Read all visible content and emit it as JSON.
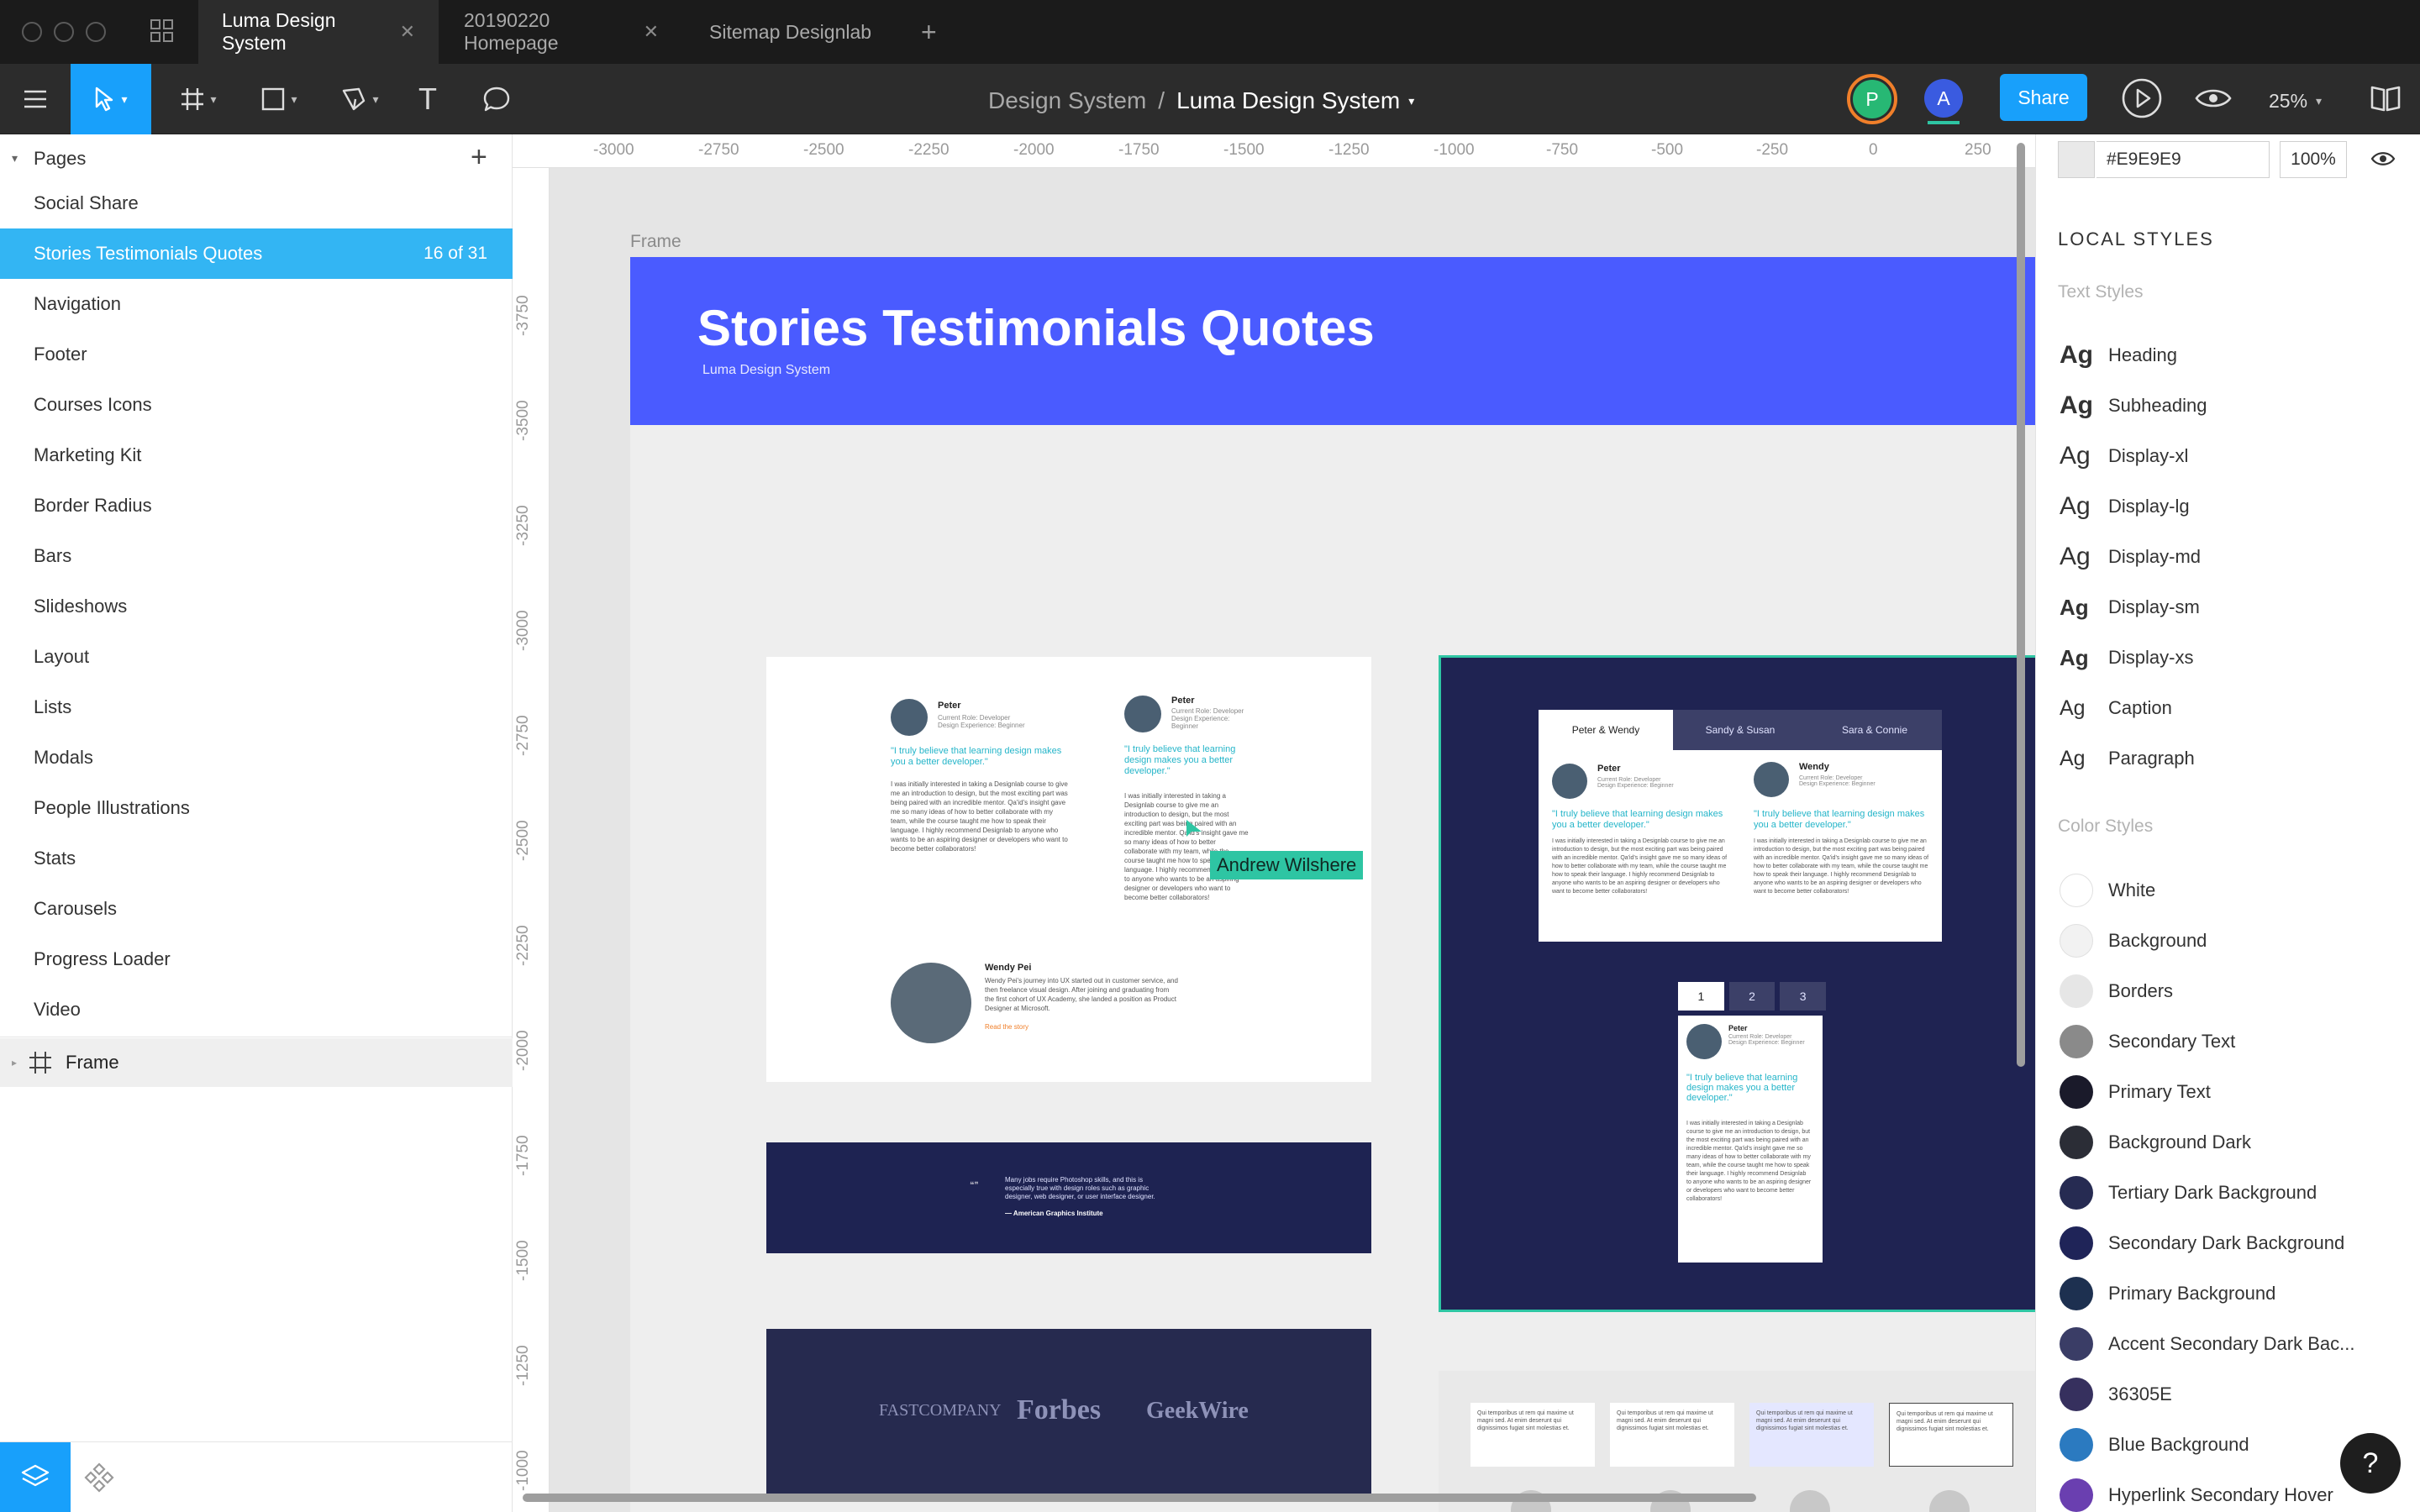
{
  "tabs": [
    {
      "label": "Luma Design System",
      "active": true
    },
    {
      "label": "20190220 Homepage",
      "active": false
    },
    {
      "label": "Sitemap Designlab",
      "active": false
    }
  ],
  "toolbar": {
    "breadcrumb_parent": "Design System",
    "breadcrumb_sep": "/",
    "breadcrumb_current": "Luma Design System",
    "avatar_p": "P",
    "avatar_a": "A",
    "share_label": "Share",
    "zoom": "25%"
  },
  "pages": {
    "header": "Pages",
    "items": [
      "Social Share",
      "Stories Testimonials Quotes",
      "Navigation",
      "Footer",
      "Courses Icons",
      "Marketing Kit",
      "Border Radius",
      "Bars",
      "Slideshows",
      "Layout",
      "Lists",
      "Modals",
      "People Illustrations",
      "Stats",
      "Carousels",
      "Progress Loader",
      "Video"
    ],
    "active_count": "16 of 31",
    "layer_frame": "Frame"
  },
  "rulers": {
    "top": [
      "-3000",
      "-2750",
      "-2500",
      "-2250",
      "-2000",
      "-1750",
      "-1500",
      "-1250",
      "-1000",
      "-750",
      "-500",
      "-250",
      "0",
      "250"
    ],
    "left": [
      "-3750",
      "-3500",
      "-3250",
      "-3000",
      "-2750",
      "-2500",
      "-2250",
      "-2000",
      "-1750",
      "-1500",
      "-1250",
      "-1000"
    ]
  },
  "canvas": {
    "frame_label": "Frame",
    "banner_title": "Stories Testimonials Quotes",
    "banner_subtitle": "Luma Design System",
    "cursor_label": "Andrew Wilshere",
    "card1": {
      "name1": "Peter",
      "role1": "Current Role: Developer\nDesign Experience: Beginner",
      "quote": "\"I truly believe that learning design makes you a better developer.\"",
      "body": "I was initially interested in taking a Designlab course to give me an introduction to design, but the most exciting part was being paired with an incredible mentor. Qa'id's insight gave me so many ideas of how to better collaborate with my team, while the course taught me how to speak their language. I highly recommend Designlab to anyone who wants to be an aspiring designer or developers who want to become better collaborators!",
      "name2": "Peter",
      "wendy_name": "Wendy Pei",
      "wendy_body": "Wendy Pei's journey into UX started out in customer service, and then freelance visual design. After joining and graduating from the first cohort of UX Academy, she landed a position as Product Designer at Microsoft.",
      "read_story": "Read the story"
    },
    "quote_strip": {
      "text": "Many jobs require Photoshop skills, and this is especially true with design roles such as graphic designer, web designer, or user interface designer.",
      "source": "— American Graphics Institute"
    },
    "logos": [
      "FASTCOMPANY",
      "Forbes",
      "GeekWire"
    ],
    "tabs_card": {
      "tabs": [
        "Peter & Wendy",
        "Sandy & Susan",
        "Sara & Connie"
      ],
      "name1": "Peter",
      "name2": "Wendy",
      "role": "Current Role: Developer\nDesign Experience: Beginner",
      "quote": "\"I truly believe that learning design makes you a better developer.\""
    },
    "pager": [
      "1",
      "2",
      "3"
    ],
    "mini_text": "Qui temporibus ut rem qui maxime ut magni sed. At enim deserunt qui dignissimos fugiat sint molestias et."
  },
  "right": {
    "fill_hex": "#E9E9E9",
    "fill_opacity": "100%",
    "local_styles": "LOCAL STYLES",
    "text_styles_header": "Text Styles",
    "text_styles": [
      {
        "sample": "Ag",
        "name": "Heading",
        "weight": "bold"
      },
      {
        "sample": "Ag",
        "name": "Subheading",
        "weight": "bold"
      },
      {
        "sample": "Ag",
        "name": "Display-xl",
        "weight": "normal"
      },
      {
        "sample": "Ag",
        "name": "Display-lg",
        "weight": "normal"
      },
      {
        "sample": "Ag",
        "name": "Display-md",
        "weight": "normal"
      },
      {
        "sample": "Ag",
        "name": "Display-sm",
        "weight": "bold"
      },
      {
        "sample": "Ag",
        "name": "Display-xs",
        "weight": "bold"
      },
      {
        "sample": "Ag",
        "name": "Caption",
        "weight": "normal"
      },
      {
        "sample": "Ag",
        "name": "Paragraph",
        "weight": "normal"
      }
    ],
    "color_styles_header": "Color Styles",
    "color_styles": [
      {
        "name": "White",
        "color": "#FFFFFF"
      },
      {
        "name": "Background",
        "color": "#F2F2F2"
      },
      {
        "name": "Borders",
        "color": "#E6E6E6"
      },
      {
        "name": "Secondary Text",
        "color": "#8A8A8A"
      },
      {
        "name": "Primary Text",
        "color": "#1A1A2A"
      },
      {
        "name": "Background Dark",
        "color": "#2B2D36"
      },
      {
        "name": "Tertiary Dark Background",
        "color": "#262B52"
      },
      {
        "name": "Secondary Dark Background",
        "color": "#1F2458"
      },
      {
        "name": "Primary Background",
        "color": "#1D3050"
      },
      {
        "name": "Accent Secondary Dark Bac...",
        "color": "#3A3D66"
      },
      {
        "name": "36305E",
        "color": "#36305E"
      },
      {
        "name": "Blue Background",
        "color": "#2B7AC0"
      },
      {
        "name": "Hyperlink Secondary Hover",
        "color": "#6A3FB0"
      }
    ]
  },
  "colors": {
    "accent": "#18A0FB",
    "banner": "#4A5BFF",
    "navy": "#1E2352",
    "selection_green": "#2EC5A3"
  }
}
